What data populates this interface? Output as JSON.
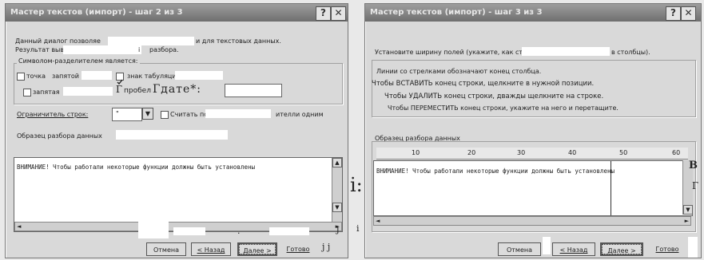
{
  "left_dialog": {
    "title": "Мастер текстов (импорт) - шаг 2 из 3",
    "help_btn": "?",
    "close_btn": "✕",
    "description_line1": "Данный диалог позволяе",
    "description_line1b": "и для текстовых данных.",
    "description_line2a": "Результат выво",
    "description_line2b": "разбора.",
    "description_mark": "i",
    "delimiters_group_label": "Символом-разделителем является:",
    "opt_dot": "точка",
    "opt_comma_label": "запятой",
    "opt_tab": "знак табуляции",
    "opt_comma": "запятая",
    "opt_space": "пробел",
    "other_label": "Гдате*:",
    "text_qualifier_label": "Ограничитель строк:",
    "text_qualifier_value": "\"",
    "consecutive_label": "Считать пс",
    "consecutive_label_tail": "ителли одним",
    "preview_label": "Образец разбора данных",
    "preview_line1": "ВНИМАНИЕ! Чтобы работали некоторые функции должны быть установлены",
    "btn_cancel": "Отмена",
    "btn_back": "< Назад",
    "btn_next": "Далее >",
    "btn_finish": "Готово",
    "stray_j1": "j",
    "stray_j2": "j j",
    "stray_dot": "."
  },
  "right_dialog": {
    "title": "Мастер текстов (импорт) - шаг 3 из 3",
    "help_btn": "?",
    "close_btn": "✕",
    "intro_a": "Установите ширину полей (укажите, как строк",
    "intro_b": "в столбцы).",
    "info_line1": "Линии со стрелками обозначают конец столбца.",
    "info_line2": "Чтобы ВСТАВИТЬ конец строки, щелкните в нужной позиции.",
    "info_line3": "Чтобы УДАЛИТЬ конец строки, дважды щелкните на строке.",
    "info_line4": "Чтобы ПЕРЕМЕСТИТЬ конец строки, укажите на него и перетащите.",
    "preview_label": "Образец разбора данных",
    "ruler": [
      "10",
      "20",
      "30",
      "40",
      "50",
      "60"
    ],
    "preview_line1": "ВНИМАНИЕ! Чтобы работали некоторые функции должны быть установлены",
    "btn_cancel": "Отмена",
    "btn_back": "< Назад",
    "btn_next": "Далее >",
    "btn_finish": "Готово"
  },
  "between": {
    "mark": "i:",
    "stray_i": "i"
  },
  "right_edge": {
    "char_b": "В",
    "char_g": "Г"
  }
}
